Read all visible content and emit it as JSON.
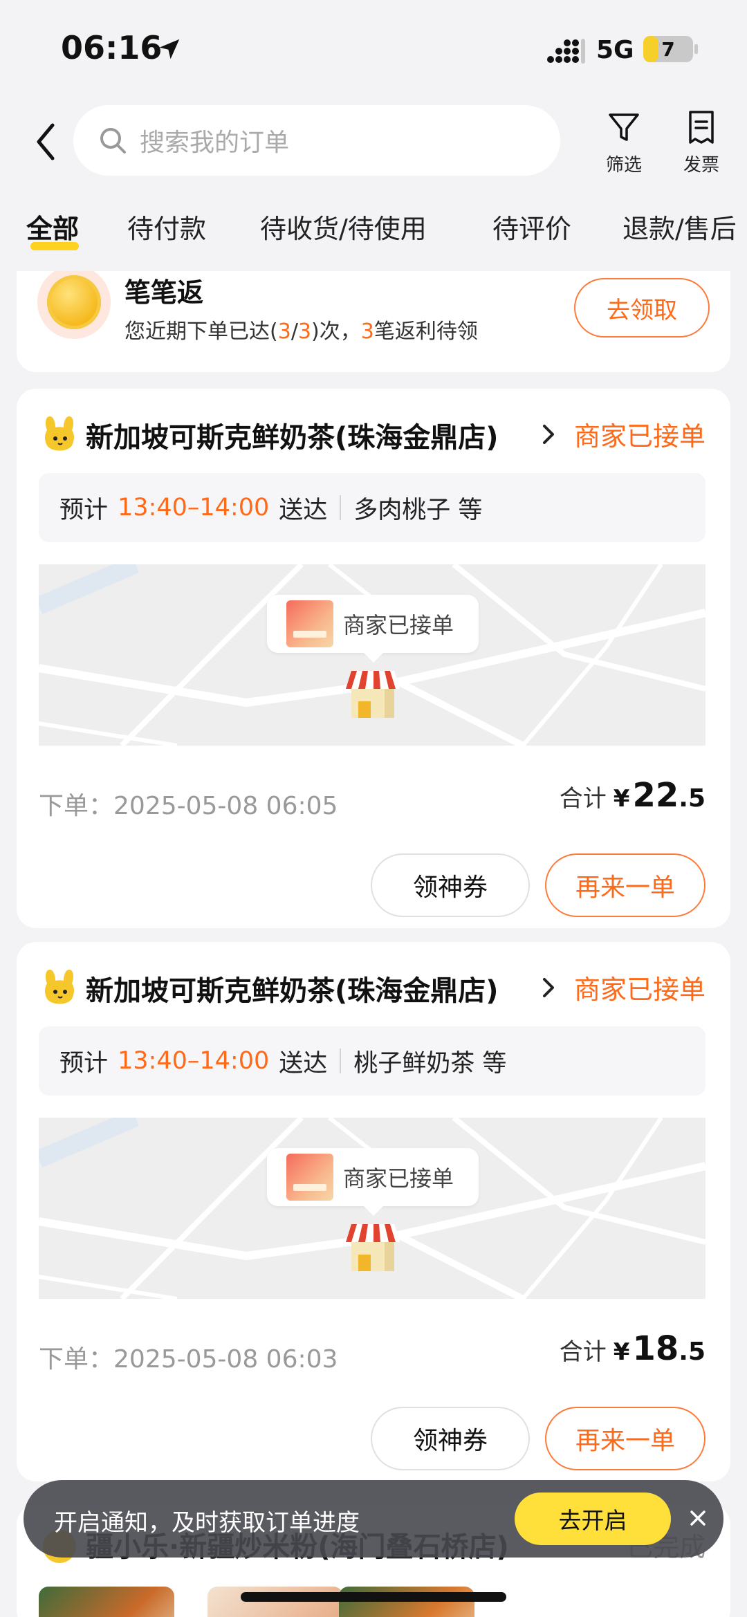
{
  "status_bar": {
    "time": "06:16",
    "network": "5G",
    "battery_level": "7",
    "battery_fraction": 0.3
  },
  "header": {
    "search_placeholder": "搜索我的订单",
    "filter_label": "筛选",
    "invoice_label": "发票",
    "icons": {
      "back": "back-chevron-icon",
      "search": "search-icon",
      "filter": "funnel-icon",
      "invoice": "receipt-icon"
    }
  },
  "tabs": [
    {
      "label": "全部",
      "active": true
    },
    {
      "label": "待付款",
      "active": false
    },
    {
      "label": "待收货/待使用",
      "active": false
    },
    {
      "label": "待评价",
      "active": false
    },
    {
      "label": "退款/售后",
      "active": false
    }
  ],
  "promo": {
    "title": "笔笔返",
    "desc_prefix": "您近期下单已达(",
    "count_done": "3",
    "slash": "/",
    "count_total": "3",
    "desc_mid": ")次，",
    "pending": "3",
    "desc_suffix": "笔返利待领",
    "button": "去领取"
  },
  "orders": [
    {
      "shop": "新加坡可斯克鲜奶茶(珠海金鼎店)",
      "status": "商家已接单",
      "eta_prefix": "预计",
      "eta_time": "13:40–14:00",
      "eta_suffix": "送达",
      "items": "多肉桃子 等",
      "map_label": "商家已接单",
      "order_time_label": "下单：",
      "order_time": "2025-05-08 06:05",
      "total_label": "合计",
      "currency": "¥",
      "total_int": "22",
      "total_dec": ".5",
      "coupon_button": "领神券",
      "reorder_button": "再来一单"
    },
    {
      "shop": "新加坡可斯克鲜奶茶(珠海金鼎店)",
      "status": "商家已接单",
      "eta_prefix": "预计",
      "eta_time": "13:40–14:00",
      "eta_suffix": "送达",
      "items": "桃子鲜奶茶 等",
      "map_label": "商家已接单",
      "order_time_label": "下单：",
      "order_time": "2025-05-08 06:03",
      "total_label": "合计",
      "currency": "¥",
      "total_int": "18",
      "total_dec": ".5",
      "coupon_button": "领神券",
      "reorder_button": "再来一单"
    }
  ],
  "order3": {
    "shop": "疆小乐·新疆炒米粉(海门叠石桥店)",
    "status": "已完成"
  },
  "toast": {
    "text": "开启通知，及时获取订单进度",
    "button": "去开启"
  },
  "colors": {
    "accent": "#ff6a1a",
    "tab_indicator": "#ffd21f",
    "toast_button": "#ffe03a"
  }
}
